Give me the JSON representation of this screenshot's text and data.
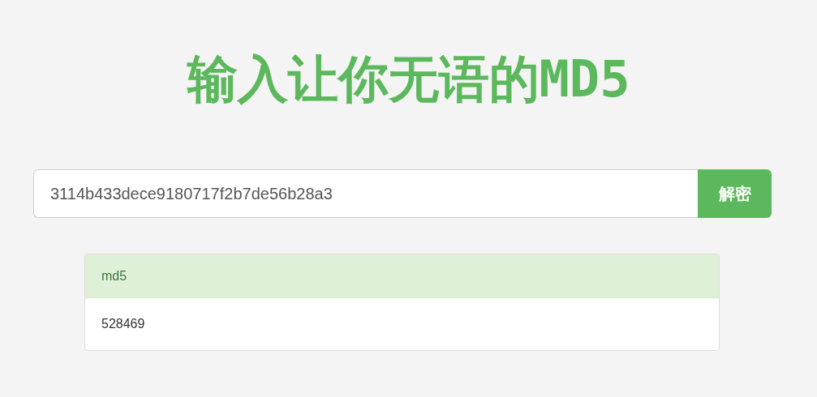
{
  "title": "输入让你无语的MD5",
  "search": {
    "value": "3114b433dece9180717f2b7de56b28a3",
    "button": "解密"
  },
  "result": {
    "heading": "md5",
    "value": "528469"
  }
}
